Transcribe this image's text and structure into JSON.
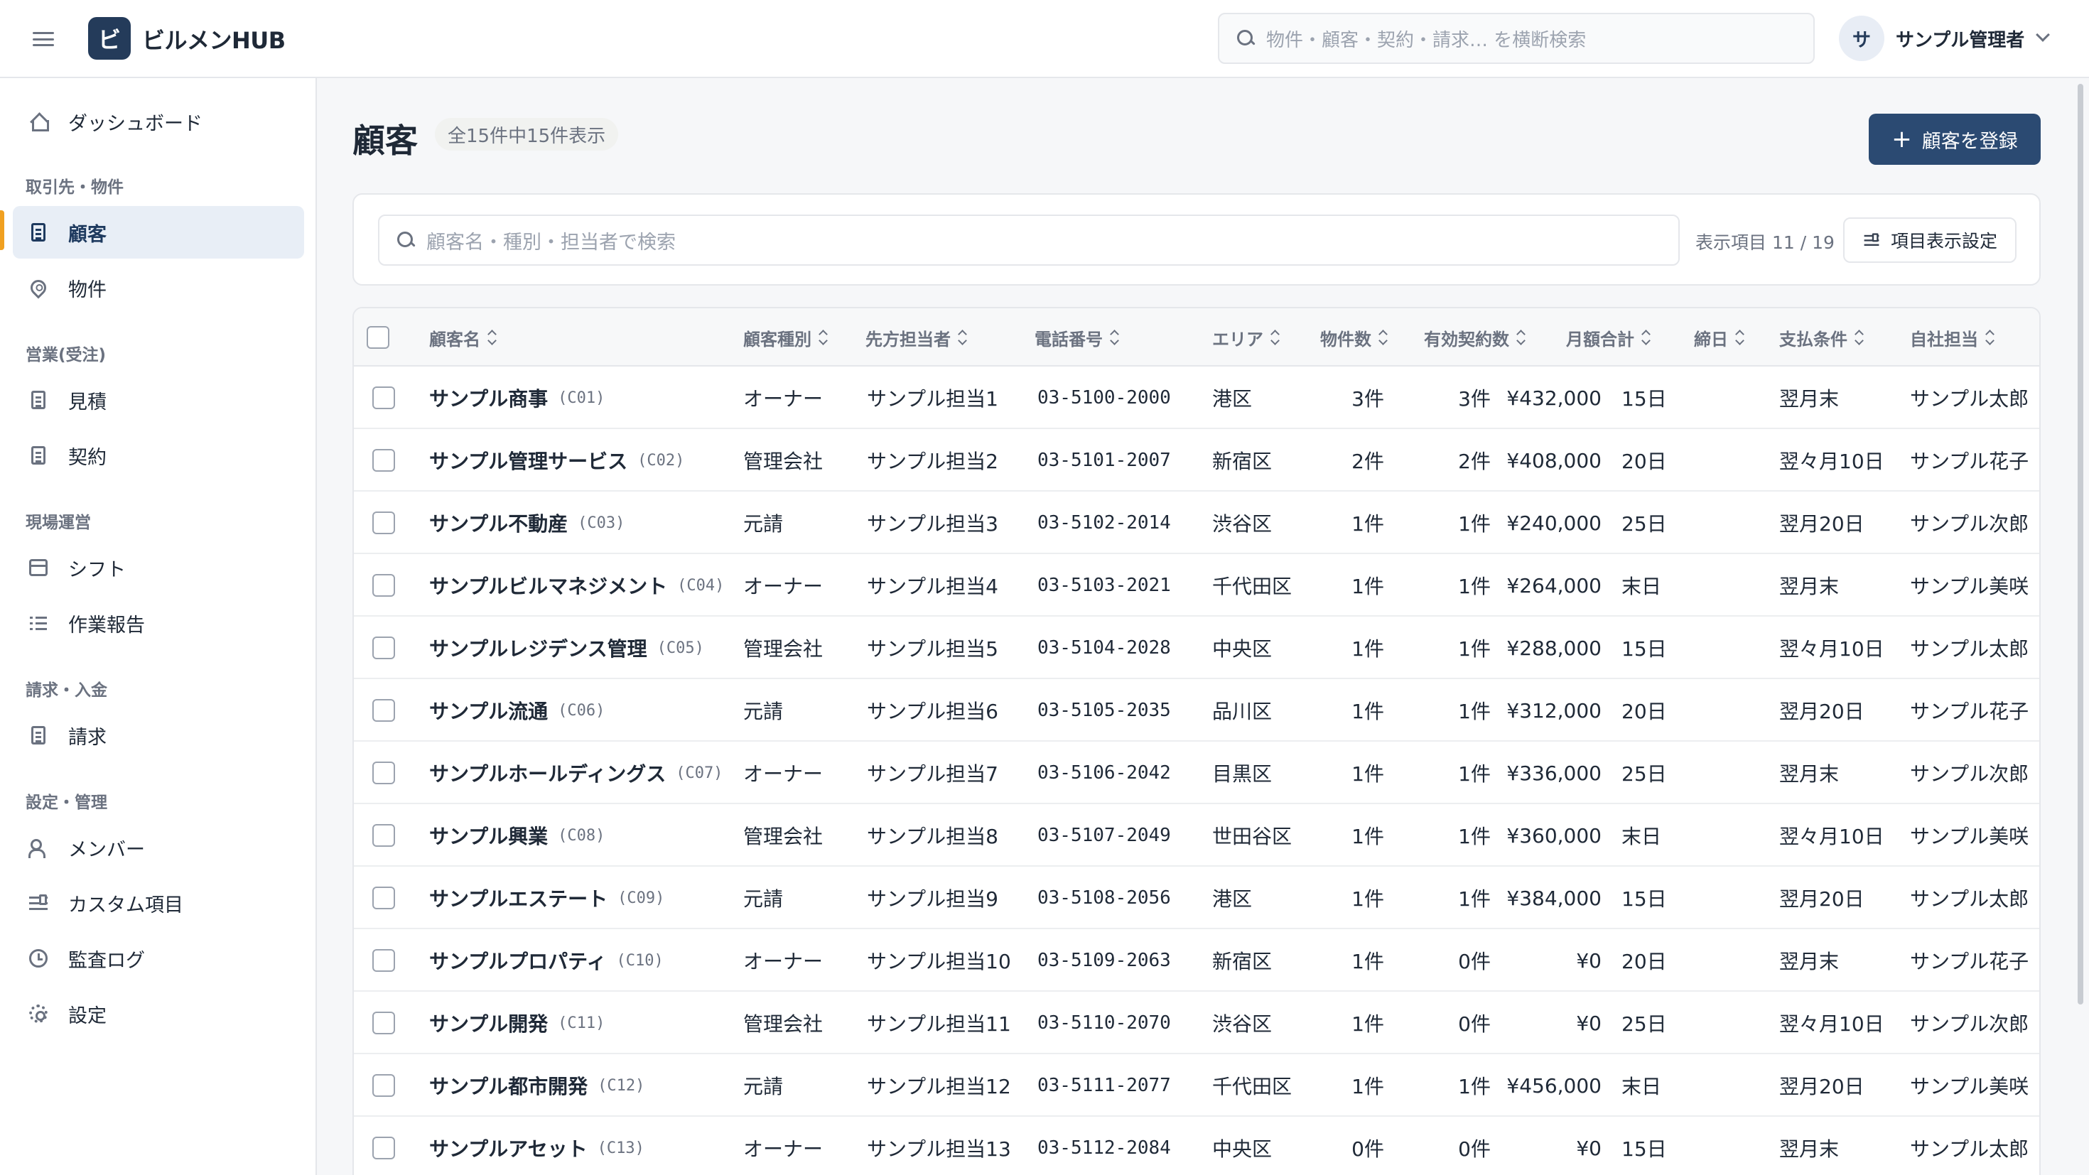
{
  "app": {
    "logo_letter": "ビ",
    "name": "ビルメンHUB"
  },
  "header": {
    "search_placeholder": "物件・顧客・契約・請求… を横断検索",
    "user_initial": "サ",
    "user_name": "サンプル管理者"
  },
  "sidebar": {
    "dashboard": "ダッシュボード",
    "sections": [
      {
        "label": "取引先・物件",
        "items": [
          "顧客",
          "物件"
        ]
      },
      {
        "label": "営業(受注)",
        "items": [
          "見積",
          "契約"
        ]
      },
      {
        "label": "現場運営",
        "items": [
          "シフト",
          "作業報告"
        ]
      },
      {
        "label": "請求・入金",
        "items": [
          "請求"
        ]
      },
      {
        "label": "設定・管理",
        "items": [
          "メンバー",
          "カスタム項目",
          "監査ログ",
          "設定"
        ]
      }
    ],
    "active": "顧客"
  },
  "main": {
    "title": "顧客",
    "count_text": "全15件中15件表示",
    "add_button": "顧客を登録",
    "search_placeholder": "顧客名・種別・担当者で検索",
    "column_count": "表示項目 11 / 19",
    "column_settings": "項目表示設定"
  },
  "table": {
    "headers": [
      "顧客名",
      "顧客種別",
      "先方担当者",
      "電話番号",
      "エリア",
      "物件数",
      "有効契約数",
      "月額合計",
      "締日",
      "支払条件",
      "自社担当"
    ],
    "rows": [
      [
        "サンプル商事",
        "(C01)",
        "オーナー",
        "サンプル担当1",
        "03-5100-2000",
        "港区",
        "3件",
        "3件",
        "¥432,000",
        "15日",
        "翌月末",
        "サンプル太郎"
      ],
      [
        "サンプル管理サービス",
        "(C02)",
        "管理会社",
        "サンプル担当2",
        "03-5101-2007",
        "新宿区",
        "2件",
        "2件",
        "¥408,000",
        "20日",
        "翌々月10日",
        "サンプル花子"
      ],
      [
        "サンプル不動産",
        "(C03)",
        "元請",
        "サンプル担当3",
        "03-5102-2014",
        "渋谷区",
        "1件",
        "1件",
        "¥240,000",
        "25日",
        "翌月20日",
        "サンプル次郎"
      ],
      [
        "サンプルビルマネジメント",
        "(C04)",
        "オーナー",
        "サンプル担当4",
        "03-5103-2021",
        "千代田区",
        "1件",
        "1件",
        "¥264,000",
        "末日",
        "翌月末",
        "サンプル美咲"
      ],
      [
        "サンプルレジデンス管理",
        "(C05)",
        "管理会社",
        "サンプル担当5",
        "03-5104-2028",
        "中央区",
        "1件",
        "1件",
        "¥288,000",
        "15日",
        "翌々月10日",
        "サンプル太郎"
      ],
      [
        "サンプル流通",
        "(C06)",
        "元請",
        "サンプル担当6",
        "03-5105-2035",
        "品川区",
        "1件",
        "1件",
        "¥312,000",
        "20日",
        "翌月20日",
        "サンプル花子"
      ],
      [
        "サンプルホールディングス",
        "(C07)",
        "オーナー",
        "サンプル担当7",
        "03-5106-2042",
        "目黒区",
        "1件",
        "1件",
        "¥336,000",
        "25日",
        "翌月末",
        "サンプル次郎"
      ],
      [
        "サンプル興業",
        "(C08)",
        "管理会社",
        "サンプル担当8",
        "03-5107-2049",
        "世田谷区",
        "1件",
        "1件",
        "¥360,000",
        "末日",
        "翌々月10日",
        "サンプル美咲"
      ],
      [
        "サンプルエステート",
        "(C09)",
        "元請",
        "サンプル担当9",
        "03-5108-2056",
        "港区",
        "1件",
        "1件",
        "¥384,000",
        "15日",
        "翌月20日",
        "サンプル太郎"
      ],
      [
        "サンプルプロパティ",
        "(C10)",
        "オーナー",
        "サンプル担当10",
        "03-5109-2063",
        "新宿区",
        "1件",
        "0件",
        "¥0",
        "20日",
        "翌月末",
        "サンプル花子"
      ],
      [
        "サンプル開発",
        "(C11)",
        "管理会社",
        "サンプル担当11",
        "03-5110-2070",
        "渋谷区",
        "1件",
        "0件",
        "¥0",
        "25日",
        "翌々月10日",
        "サンプル次郎"
      ],
      [
        "サンプル都市開発",
        "(C12)",
        "元請",
        "サンプル担当12",
        "03-5111-2077",
        "千代田区",
        "1件",
        "1件",
        "¥456,000",
        "末日",
        "翌月20日",
        "サンプル美咲"
      ],
      [
        "サンプルアセット",
        "(C13)",
        "オーナー",
        "サンプル担当13",
        "03-5112-2084",
        "中央区",
        "0件",
        "0件",
        "¥0",
        "15日",
        "翌月末",
        "サンプル太郎"
      ]
    ]
  },
  "colors": {
    "brand": "#243b5a",
    "primary_button": "#2b4a72",
    "active_bg": "#e8eef6",
    "active_marker": "#f0a020"
  }
}
